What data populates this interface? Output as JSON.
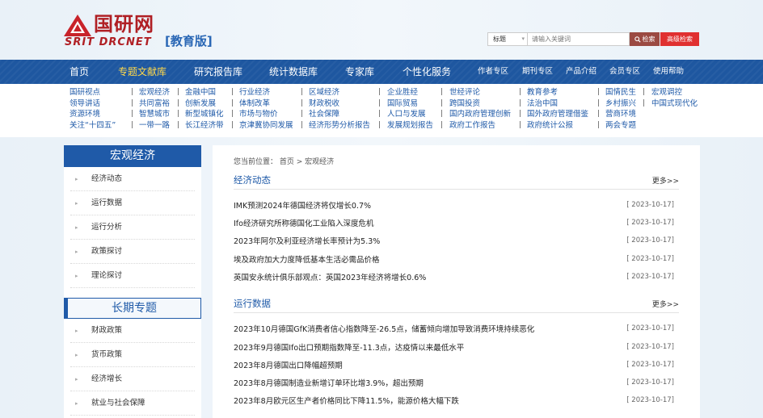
{
  "header": {
    "logo_cn": "国研网",
    "logo_en": "SRIT DRCNET",
    "logo_edu": "[教育版]",
    "search": {
      "type_label": "标题",
      "placeholder": "请输入关键词",
      "search_btn": "检索",
      "advanced_btn": "高级检索"
    }
  },
  "nav": {
    "items": [
      "首页",
      "专题文献库",
      "研究报告库",
      "统计数据库",
      "专家库",
      "个性化服务"
    ],
    "small_items": [
      "作者专区",
      "期刊专区",
      "产品介绍",
      "会员专区",
      "使用帮助"
    ]
  },
  "sublinks": {
    "columns": [
      [
        "国研视点",
        "领导讲话",
        "资源环境",
        "关注“十四五”"
      ],
      [
        "宏观经济",
        "共同富裕",
        "智慧城市",
        "一带一路"
      ],
      [
        "金融中国",
        "创新发展",
        "新型城镇化",
        "长江经济带"
      ],
      [
        "行业经济",
        "体制改革",
        "市场与物价",
        "京津冀协同发展"
      ],
      [
        "区域经济",
        "财政税收",
        "社会保障",
        "经济形势分析报告"
      ],
      [
        "企业胜经",
        "国际贸易",
        "人口与发展",
        "发展规划报告"
      ],
      [
        "世经评论",
        "跨国投资",
        "国内政府管理创新",
        "政府工作报告"
      ],
      [
        "教育参考",
        "法治中国",
        "国外政府管理借鉴",
        "政府统计公报"
      ],
      [
        "国情民生",
        "乡村振兴",
        "营商环境",
        "两会专题"
      ],
      [
        "宏观调控",
        "中国式现代化"
      ]
    ]
  },
  "sidebar": {
    "title": "宏观经济",
    "items": [
      "经济动态",
      "运行数据",
      "运行分析",
      "政策探讨",
      "理论探讨"
    ],
    "title2": "长期专题",
    "items2": [
      "财政政策",
      "货币政策",
      "经济增长",
      "就业与社会保障"
    ]
  },
  "main": {
    "breadcrumb": "您当前位置：  首页 > 宏观经济",
    "sections": [
      {
        "title": "经济动态",
        "more": "更多>>",
        "news": [
          {
            "title": "IMK预测2024年德国经济将仅增长0.7%",
            "date": "[ 2023-10-17]"
          },
          {
            "title": "Ifo经济研究所称德国化工业陷入深度危机",
            "date": "[ 2023-10-17]"
          },
          {
            "title": "2023年阿尔及利亚经济增长率预计为5.3%",
            "date": "[ 2023-10-17]"
          },
          {
            "title": "埃及政府加大力度降低基本生活必需品价格",
            "date": "[ 2023-10-17]"
          },
          {
            "title": "英国安永统计俱乐部观点：英国2023年经济将增长0.6%",
            "date": "[ 2023-10-17]"
          }
        ]
      },
      {
        "title": "运行数据",
        "more": "更多>>",
        "news": [
          {
            "title": "2023年10月德国GfK消费者信心指数降至-26.5点，储蓄倾向增加导致消费环境持续恶化",
            "date": "[ 2023-10-17]"
          },
          {
            "title": "2023年9月德国Ifo出口预期指数降至-11.3点，达疫情以来最低水平",
            "date": "[ 2023-10-17]"
          },
          {
            "title": "2023年8月德国出口降幅超预期",
            "date": "[ 2023-10-17]"
          },
          {
            "title": "2023年8月德国制造业新增订单环比增3.9%，超出预期",
            "date": "[ 2023-10-17]"
          },
          {
            "title": "2023年8月欧元区生产者价格同比下降11.5%，能源价格大幅下跌",
            "date": "[ 2023-10-17]"
          }
        ]
      }
    ]
  }
}
